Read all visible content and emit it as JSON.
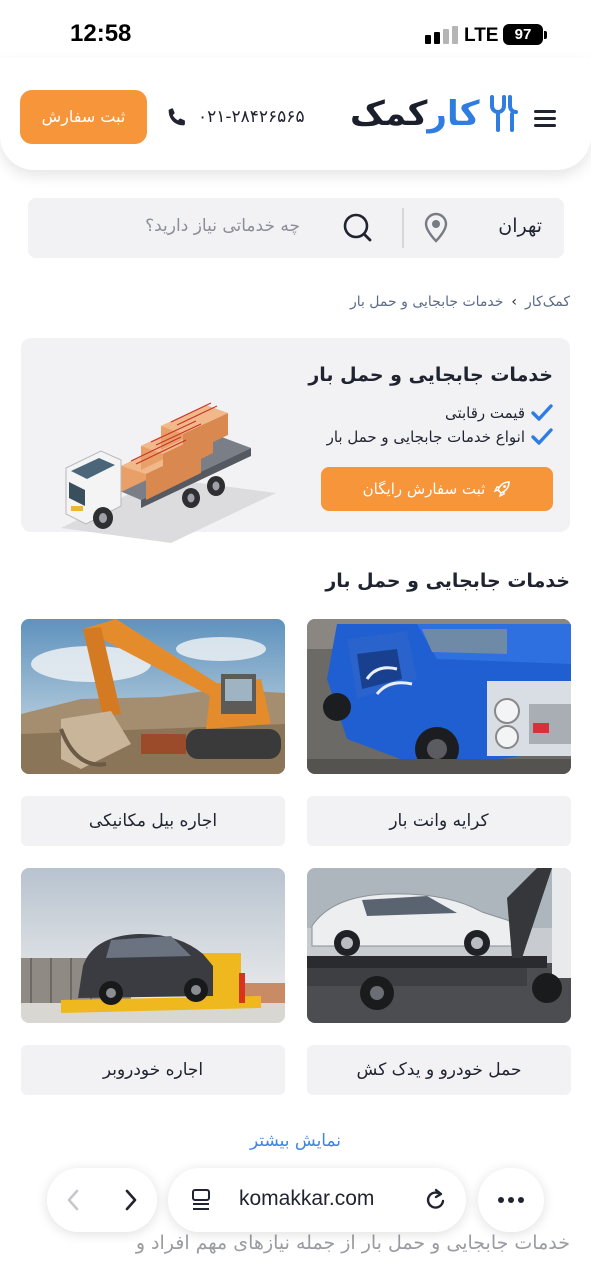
{
  "status": {
    "time": "12:58",
    "network": "LTE",
    "battery": "97"
  },
  "header": {
    "order_button": "ثبت سفارش",
    "phone": "۰۲۱-۲۸۴۲۶۵۶۵",
    "logo_main": "کمک",
    "logo_accent": "کار",
    "icons": {
      "menu": "hamburger-icon",
      "phone": "phone-icon"
    }
  },
  "search": {
    "city": "تهران",
    "placeholder": "چه خدماتی نیاز دارید؟",
    "icons": {
      "location": "map-pin-icon",
      "search": "search-icon"
    }
  },
  "breadcrumb": {
    "items": [
      "کمک‌کار",
      "خدمات جابجایی و حمل بار"
    ],
    "separator": "›"
  },
  "hero": {
    "title": "خدمات جابجایی و حمل بار",
    "features": [
      "قیمت رقابتی",
      "انواع خدمات جابجایی و حمل بار"
    ],
    "button": "ثبت سفارش رایگان",
    "button_icon": "rocket-icon"
  },
  "services": {
    "title": "خدمات جابجایی و حمل بار",
    "items": [
      {
        "label": "کرایه وانت بار",
        "image": "blue-pickup-truck"
      },
      {
        "label": "اجاره بیل مکانیکی",
        "image": "orange-excavator"
      },
      {
        "label": "حمل خودرو و یدک کش",
        "image": "tow-truck-with-car"
      },
      {
        "label": "اجاره خودروبر",
        "image": "car-carrier-trailer"
      }
    ],
    "show_more": "نمایش بیشتر"
  },
  "footer_text": "خدمات جابجایی و حمل بار از جمله نیازهای مهم افراد و",
  "browser": {
    "url": "komakkar.com"
  },
  "colors": {
    "accent": "#f7953a",
    "brand_blue": "#2f7de0",
    "card_bg": "#f2f2f4"
  }
}
